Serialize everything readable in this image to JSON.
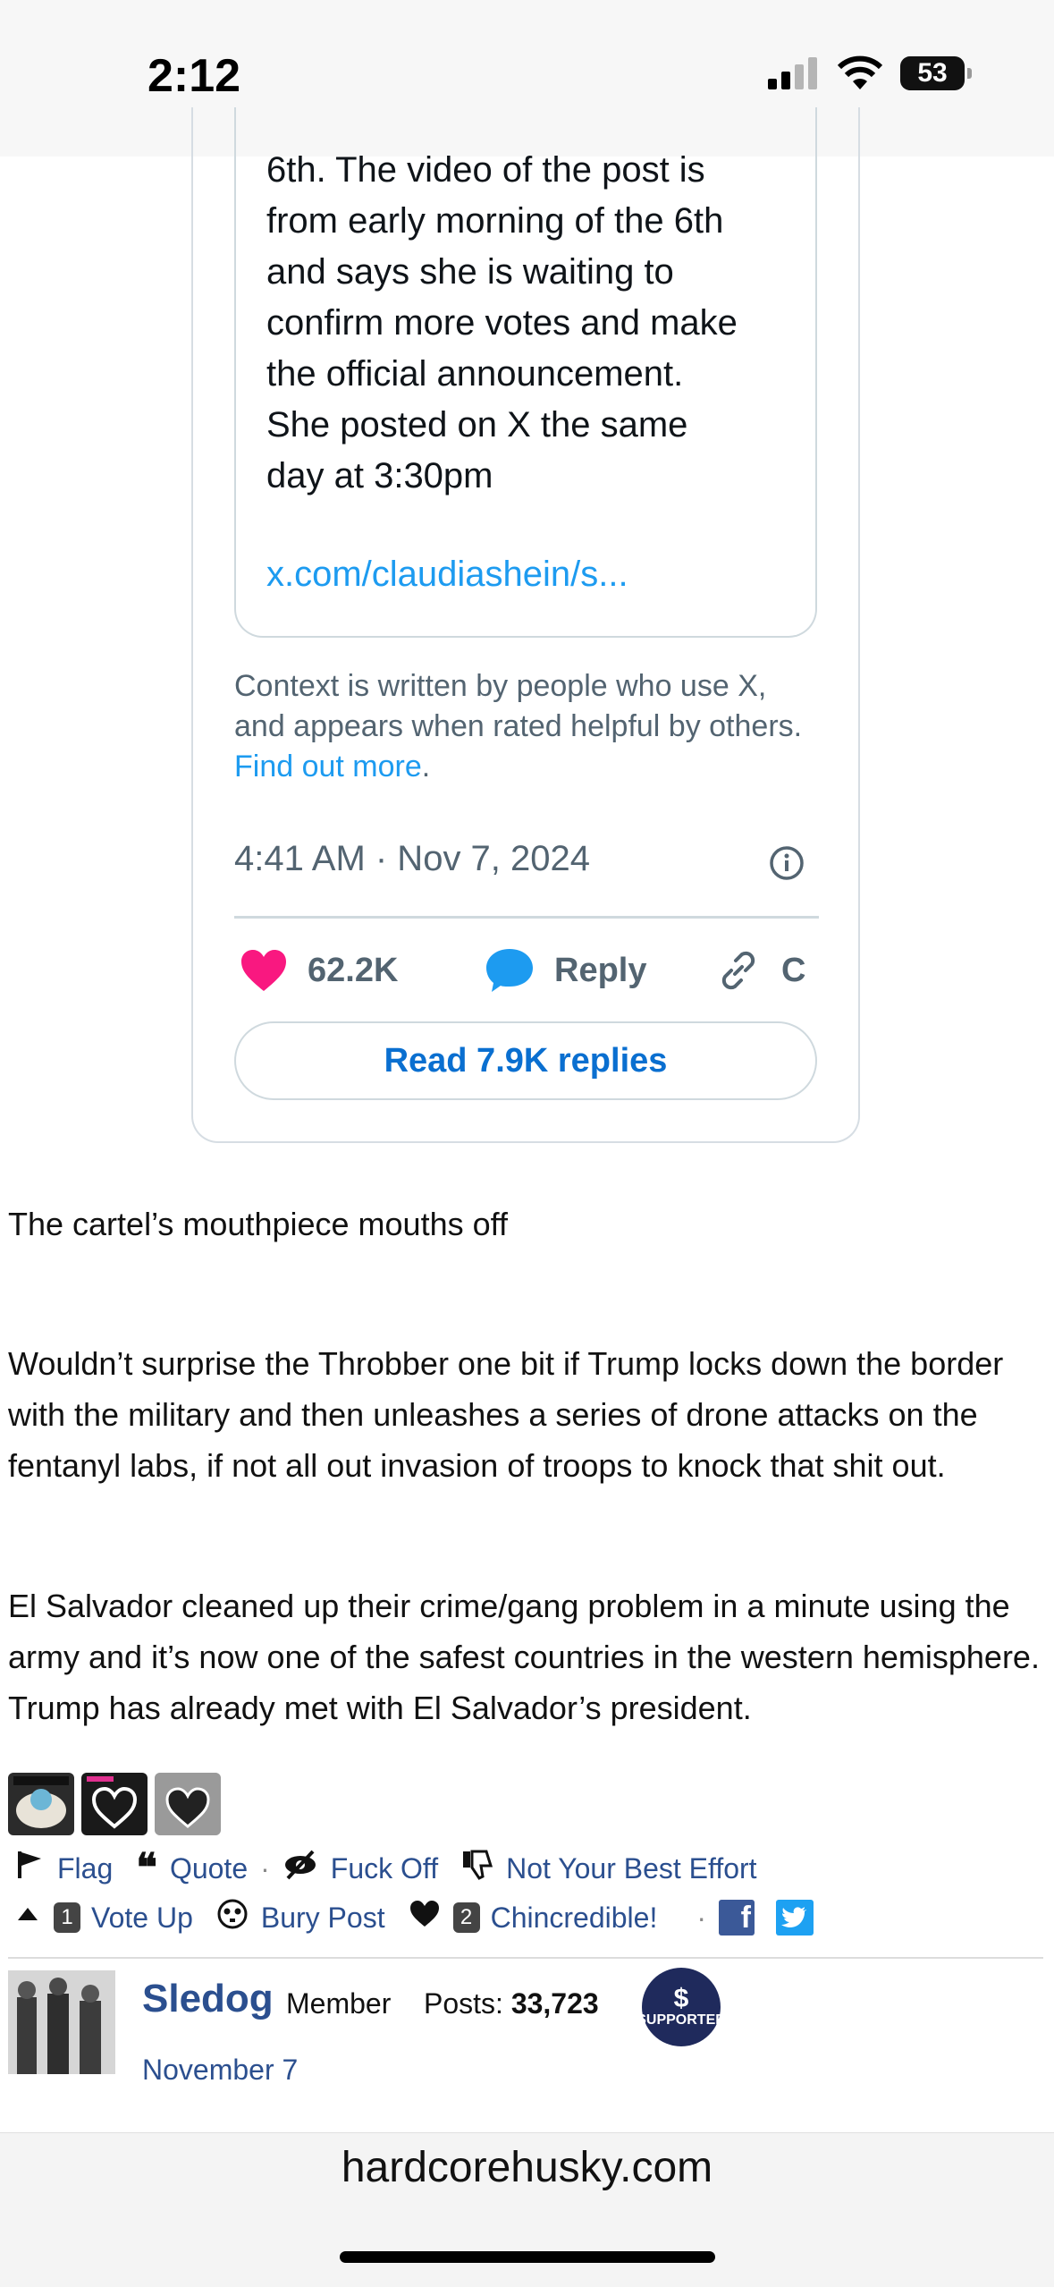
{
  "status_bar": {
    "time": "2:12",
    "battery": "53"
  },
  "tweet": {
    "note_text": "6th. The video of the post is\nfrom early morning of the 6th\nand says she is waiting to\nconfirm more votes and make\nthe official announcement.\nShe posted on X the same\nday at 3:30pm",
    "note_link": "x.com/claudiashein/s...",
    "context_text": "Context is written by people who use X, and appears when rated helpful by others.",
    "context_link": "Find out more",
    "context_period": ".",
    "timestamp": "4:41 AM · Nov 7, 2024",
    "likes": "62.2K",
    "reply_label": "Reply",
    "copy_label": "C",
    "read_replies": "Read 7.9K replies"
  },
  "post": {
    "paragraphs": [
      "The cartel’s mouthpiece mouths off",
      "Wouldn’t surprise the Throbber one bit if Trump locks down the border with the military and then unleashes a series of drone attacks on the fentanyl labs, if not all out invasion of troops to knock that shit out.",
      "El Salvador cleaned up their crime/gang problem in a minute using the army and it’s now one of the safest countries in the western hemisphere. Trump has already met with El Salvador’s president."
    ]
  },
  "reactions": {
    "flag": "Flag",
    "quote": "Quote",
    "fuck_off": "Fuck Off",
    "not_best": "Not Your Best Effort",
    "vote_up_count": "1",
    "vote_up": "Vote Up",
    "bury": "Bury Post",
    "chin_count": "2",
    "chin": "Chincredible!",
    "dot": "·"
  },
  "author": {
    "name": "Sledog",
    "role": "Member",
    "posts_label": "Posts:",
    "posts_count": "33,723",
    "badge_symbol": "$",
    "badge_label": "SUPPORTER",
    "date": "November 7"
  },
  "browser": {
    "domain": "hardcorehusky.com"
  },
  "colors": {
    "link_blue": "#1d9bf0",
    "forum_blue": "#2b4f8f",
    "like_pink": "#f91880"
  }
}
